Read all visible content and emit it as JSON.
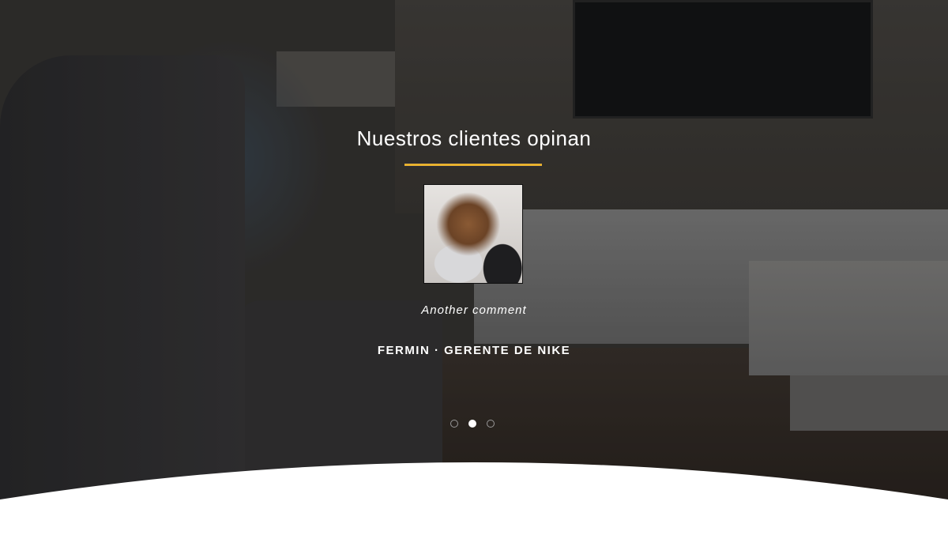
{
  "testimonials": {
    "title": "Nuestros clientes opinan",
    "accent_color": "#e7b12f",
    "current": {
      "comment": "Another comment",
      "author": "FERMIN · GERENTE DE NIKE"
    },
    "pagination": {
      "total": 3,
      "active_index": 1
    }
  }
}
